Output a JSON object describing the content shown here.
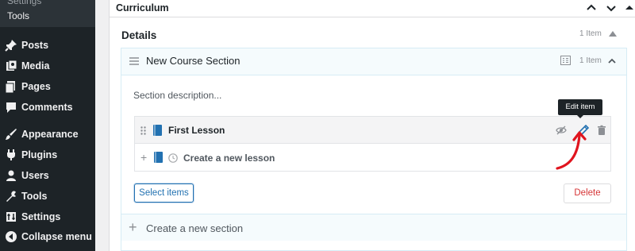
{
  "sidebar": {
    "partial_item": "Settings",
    "submenu_tools": "Tools",
    "items": [
      {
        "label": "Posts",
        "icon": "pin-icon"
      },
      {
        "label": "Media",
        "icon": "media-icon"
      },
      {
        "label": "Pages",
        "icon": "pages-icon"
      },
      {
        "label": "Comments",
        "icon": "comments-icon"
      },
      {
        "label": "Appearance",
        "icon": "brush-icon"
      },
      {
        "label": "Plugins",
        "icon": "plugin-icon"
      },
      {
        "label": "Users",
        "icon": "user-icon"
      },
      {
        "label": "Tools",
        "icon": "wrench-icon"
      },
      {
        "label": "Settings",
        "icon": "settings-icon"
      },
      {
        "label": "Collapse menu",
        "icon": "collapse-icon"
      }
    ]
  },
  "curriculum": {
    "title": "Curriculum",
    "details": {
      "title": "Details",
      "count": "1 Item"
    },
    "section": {
      "title": "New Course Section",
      "count": "1 Item",
      "description_placeholder": "Section description...",
      "lessons": [
        {
          "title": "First Lesson"
        }
      ],
      "new_lesson_label": "Create a new lesson",
      "select_items_label": "Select items",
      "delete_label": "Delete"
    },
    "new_section_label": "Create a new section"
  },
  "tooltip": {
    "text": "Edit item"
  },
  "colors": {
    "sidebar_bg": "#1d2327",
    "accent": "#2271b1",
    "danger": "#d63638",
    "annotation": "#e0141e"
  }
}
